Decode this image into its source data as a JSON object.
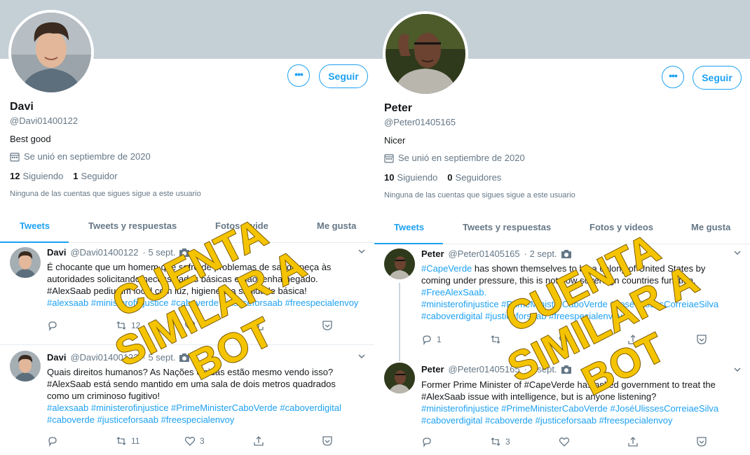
{
  "profiles": [
    {
      "name": "Davi",
      "handle": "@Davi01400122",
      "bio": "Best good",
      "joined": "Se unió en septiembre de 2020",
      "following_count": "12",
      "following_label": "Siguiendo",
      "followers_count": "1",
      "followers_label": "Seguidor",
      "follow_button": "Seguir",
      "more_button": "•••",
      "notice": "Ninguna de las cuentas que sigues sigue a este usuario",
      "tabs": [
        "Tweets",
        "Tweets y respuestas",
        "Fotos y vide",
        "Me gusta"
      ],
      "tweets": [
        {
          "name": "Davi",
          "handle": "@Davi01400122",
          "date": "· 5 sept.",
          "lines": [
            "É chocante que um homem que sofre de problemas de saúde peça às",
            "autoridades solicitando necessidades básicas e não tenha negado.",
            "#AlexSaab pediu um local com luz, higiene e a sanidade básica!",
            "#alexsaab #ministerofinjustice #caboverde #justiceforsaab #freespecialenvoy"
          ],
          "reply_count": "",
          "retweet_count": "12",
          "like_count": ""
        },
        {
          "name": "Davi",
          "handle": "@Davi01400122",
          "date": "· 5 sept.",
          "lines": [
            "Quais direitos humanos?  As Nações Unidas estão mesmo vendo isso?",
            "#AlexSaab está sendo mantido em uma sala de dois metros quadrados",
            "como um criminoso fugitivo!",
            "#alexsaab #ministerofinjustice #PrimeMinisterCaboVerde #caboverdigital",
            "#caboverde #justiceforsaab #freespecialenvoy"
          ],
          "reply_count": "",
          "retweet_count": "11",
          "like_count": "3"
        }
      ]
    },
    {
      "name": "Peter",
      "handle": "@Peter01405165",
      "bio": "Nicer",
      "joined": "Se unió en septiembre de 2020",
      "following_count": "10",
      "following_label": "Siguiendo",
      "followers_count": "0",
      "followers_label": "Seguidores",
      "follow_button": "Seguir",
      "more_button": "•••",
      "notice": "Ninguna de las cuentas que sigues sigue a este usuario",
      "tabs": [
        "Tweets",
        "Tweets y respuestas",
        "Fotos y videos",
        "Me gusta"
      ],
      "tweets": [
        {
          "name": "Peter",
          "handle": "@Peter01405165",
          "date": "· 2 sept.",
          "lines": [
            "#CapeVerde has shown themselves to be a colony of United States by",
            "coming under pressure, this is not how sovereign countries function.",
            "#FreeAlexSaab.",
            "#ministerofinjustice #PrimeMinisterCaboVerde #JoséUlissesCorreiaeSilva",
            "#caboverdigital #justiceforsaab #freespecialenvoy"
          ],
          "reply_count": "1",
          "retweet_count": "",
          "like_count": ""
        },
        {
          "name": "Peter",
          "handle": "@Peter01405165",
          "date": "· 2 sept.",
          "lines": [
            "Former Prime Minister of #CapeVerde has asked government to treat the",
            "#AlexSaab issue with intelligence, but is anyone listening?",
            "#ministerofinjustice #PrimeMinisterCaboVerde #JoséUlissesCorreiaeSilva",
            "#caboverdigital #caboverde #justiceforsaab #freespecialenvoy"
          ],
          "reply_count": "",
          "retweet_count": "3",
          "like_count": ""
        }
      ]
    }
  ],
  "stamp": {
    "lines": [
      "CUENTA",
      "SIMILAR A",
      "BOT"
    ],
    "color": "#f5c400",
    "outline": "#7a5a00"
  },
  "colors": {
    "accent": "#1da1f2",
    "muted": "#657786",
    "banner": "#c4cfd6"
  },
  "icons": [
    "calendar-icon",
    "camera-icon",
    "chevron-down-icon",
    "reply-icon",
    "retweet-icon",
    "like-icon",
    "share-icon",
    "analytics-icon"
  ]
}
